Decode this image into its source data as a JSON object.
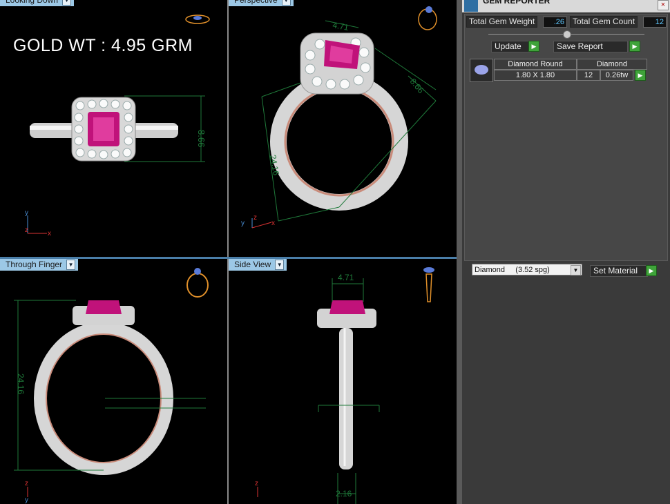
{
  "viewports": {
    "top_left": {
      "label": "Looking Down",
      "gold_weight": "GOLD WT : 4.95 GRM",
      "dim": "8.66"
    },
    "top_right": {
      "label": "Perspective",
      "dim_top": "4.71",
      "dim_side": "8.66",
      "dim_height": "24.16"
    },
    "bottom_left": {
      "label": "Through Finger",
      "dim_height": "24.16"
    },
    "bottom_right": {
      "label": "Side View",
      "dim_top": "4.71",
      "dim_bottom": "2.16"
    }
  },
  "axes": {
    "x": "x",
    "y": "y",
    "z": "z"
  },
  "gem_reporter": {
    "title": "GEM REPORTER",
    "total_weight_label": "Total Gem Weight",
    "total_weight_value": ".26",
    "total_count_label": "Total Gem Count",
    "total_count_value": "12",
    "update_label": "Update",
    "save_report_label": "Save Report",
    "table": {
      "headers": [
        "Diamond Round",
        "Diamond"
      ],
      "row": {
        "size": "1.80 X 1.80",
        "count": "12",
        "weight": "0.26tw"
      }
    },
    "material_select": "Diamond     (3.52 spg)",
    "set_material_label": "Set Material"
  },
  "colors": {
    "accent": "#9cc8e6",
    "ruby": "#c0127a",
    "dim_line": "#1f7a3a",
    "metal": "#e8e8e8"
  }
}
